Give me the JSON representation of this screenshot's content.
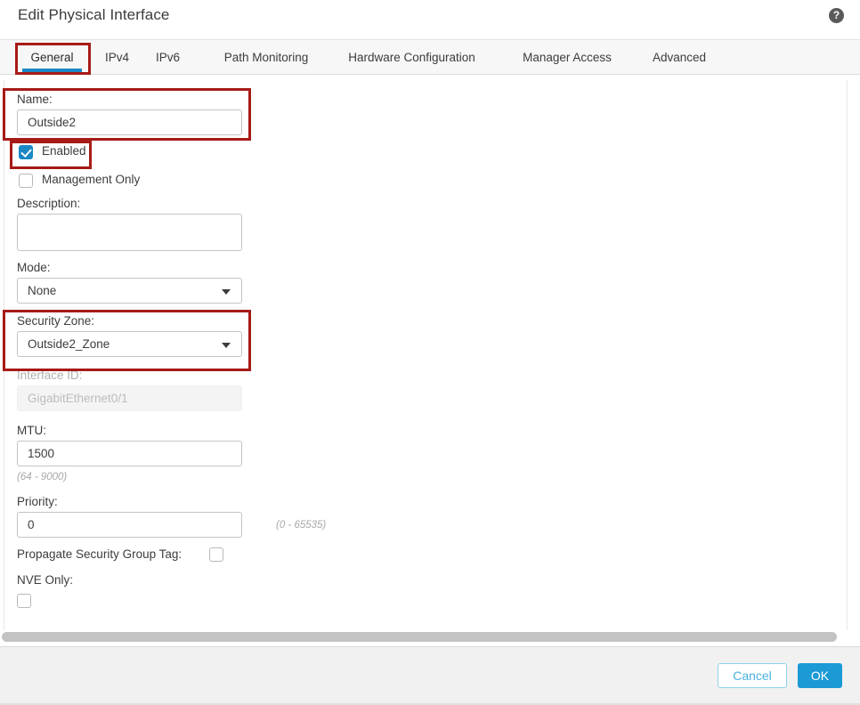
{
  "window": {
    "title": "Edit Physical Interface",
    "help_icon": "help-circle-icon",
    "help_glyph": "?"
  },
  "tabs": [
    {
      "label": "General",
      "active": true
    },
    {
      "label": "IPv4",
      "active": false
    },
    {
      "label": "IPv6",
      "active": false
    },
    {
      "label": "Path Monitoring",
      "active": false
    },
    {
      "label": "Hardware Configuration",
      "active": false
    },
    {
      "label": "Manager Access",
      "active": false
    },
    {
      "label": "Advanced",
      "active": false
    }
  ],
  "form": {
    "name": {
      "label": "Name:",
      "value": "Outside2",
      "placeholder": ""
    },
    "enabled": {
      "label": "Enabled",
      "checked": true
    },
    "management_only": {
      "label": "Management Only",
      "checked": false
    },
    "description": {
      "label": "Description:",
      "value": "",
      "placeholder": ""
    },
    "mode": {
      "label": "Mode:",
      "value": "None"
    },
    "security_zone": {
      "label": "Security Zone:",
      "value": "Outside2_Zone"
    },
    "interface_id": {
      "label": "Interface ID:",
      "value": "GigabitEthernet0/1",
      "disabled": true
    },
    "mtu": {
      "label": "MTU:",
      "value": "1500",
      "hint": "(64 - 9000)"
    },
    "priority": {
      "label": "Priority:",
      "value": "0",
      "hint": "(0 - 65535)"
    },
    "propagate_sgt": {
      "label": "Propagate Security Group Tag:",
      "checked": false
    },
    "nve_only": {
      "label": "NVE Only:",
      "checked": false
    }
  },
  "footer": {
    "cancel_label": "Cancel",
    "ok_label": "OK"
  },
  "colors": {
    "accent": "#1b87c4",
    "primary_button": "#1b9ad6",
    "annotation": "#a61b17",
    "text": "#3c3c3c",
    "disabled_text": "#bdbdbd"
  }
}
